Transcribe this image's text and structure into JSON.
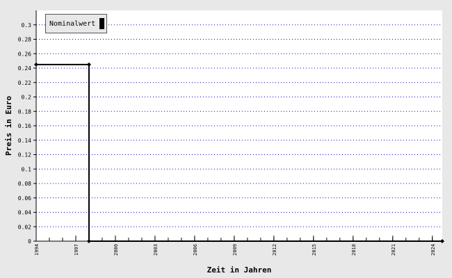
{
  "chart_data": {
    "type": "line",
    "step": true,
    "xlabel": "Zeit in Jahren",
    "ylabel": "Preis in Euro",
    "xlim": [
      1994,
      2024.75
    ],
    "ylim": [
      0,
      0.32
    ],
    "x_ticks": [
      1994,
      1997,
      2000,
      2003,
      2006,
      2009,
      2012,
      2015,
      2018,
      2021,
      2024
    ],
    "y_ticks": [
      0,
      0.02,
      0.04,
      0.06,
      0.08,
      0.1,
      0.12,
      0.14,
      0.16,
      0.18,
      0.2,
      0.22,
      0.24,
      0.26,
      0.28,
      0.3
    ],
    "grid": "horizontal dotted",
    "legend_position": "top-left",
    "series": [
      {
        "name": "Nominalwert",
        "color": "#000000",
        "points": [
          {
            "x": 1994,
            "y": 0.245
          },
          {
            "x": 1998,
            "y": 0.245
          },
          {
            "x": 1998,
            "y": 0
          },
          {
            "x": 2024.75,
            "y": 0
          }
        ]
      }
    ]
  },
  "colors": {
    "background": "#e8e8e8",
    "plot_background": "#ffffff",
    "grid": "#0000cc",
    "series": "#000000"
  }
}
